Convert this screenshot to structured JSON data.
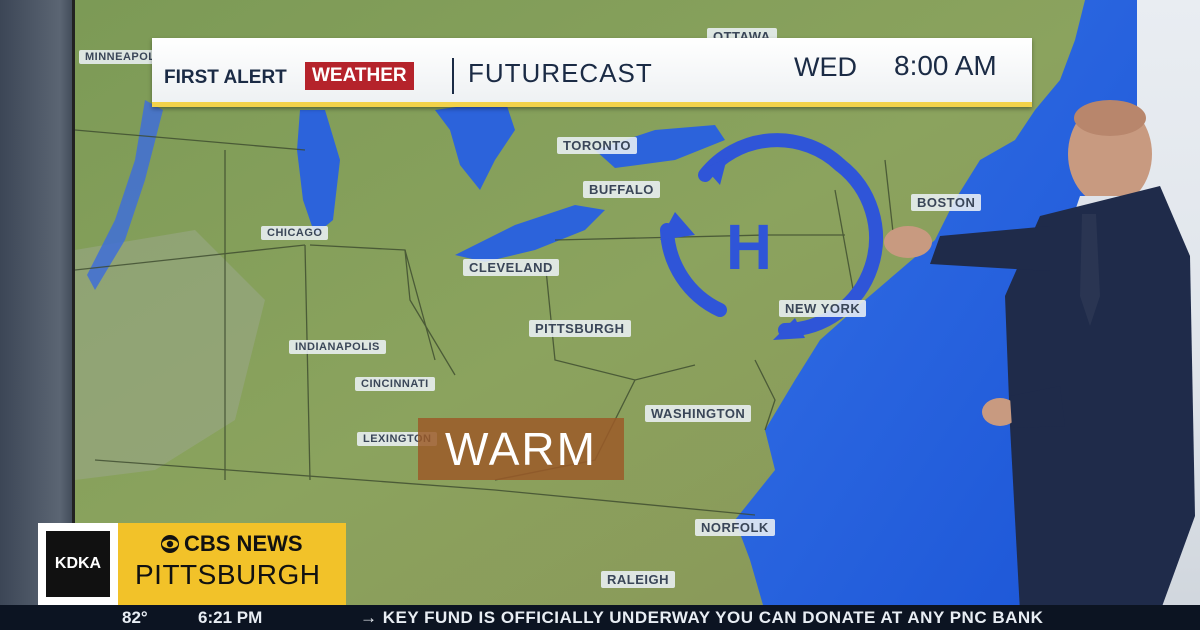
{
  "banner": {
    "first_alert": "FIRST ALERT",
    "weather": "WEATHER",
    "segment": "FUTURECAST",
    "day": "WED",
    "time": "8:00 AM"
  },
  "map": {
    "cities": [
      {
        "name": "TORONTO"
      },
      {
        "name": "BUFFALO"
      },
      {
        "name": "BOSTON"
      },
      {
        "name": "CHICAGO"
      },
      {
        "name": "CLEVELAND"
      },
      {
        "name": "NEW YORK"
      },
      {
        "name": "PITTSBURGH"
      },
      {
        "name": "INDIANAPOLIS"
      },
      {
        "name": "CINCINNATI"
      },
      {
        "name": "WASHINGTON"
      },
      {
        "name": "LEXINGTON"
      },
      {
        "name": "NORFOLK"
      },
      {
        "name": "RALEIGH"
      },
      {
        "name": "OTTAWA"
      },
      {
        "name": "MINNEAPOLIS"
      }
    ],
    "pressure_symbol": "H",
    "warm_label": "WARM"
  },
  "lower_third": {
    "station": "KDKA",
    "network": "CBS NEWS",
    "city": "PITTSBURGH"
  },
  "ticker": {
    "temperature": "82°",
    "clock": "6:21 PM",
    "crawl": "→ KEY FUND IS OFFICIALLY UNDERWAY  YOU CAN DONATE AT ANY PNC BANK"
  },
  "colors": {
    "accent_red": "#b5232b",
    "cbs_yellow": "#f2c229",
    "banner_underline": "#f2d24a",
    "pressure_blue": "#2f55d8",
    "ocean_blue": "#1f5fe0"
  }
}
